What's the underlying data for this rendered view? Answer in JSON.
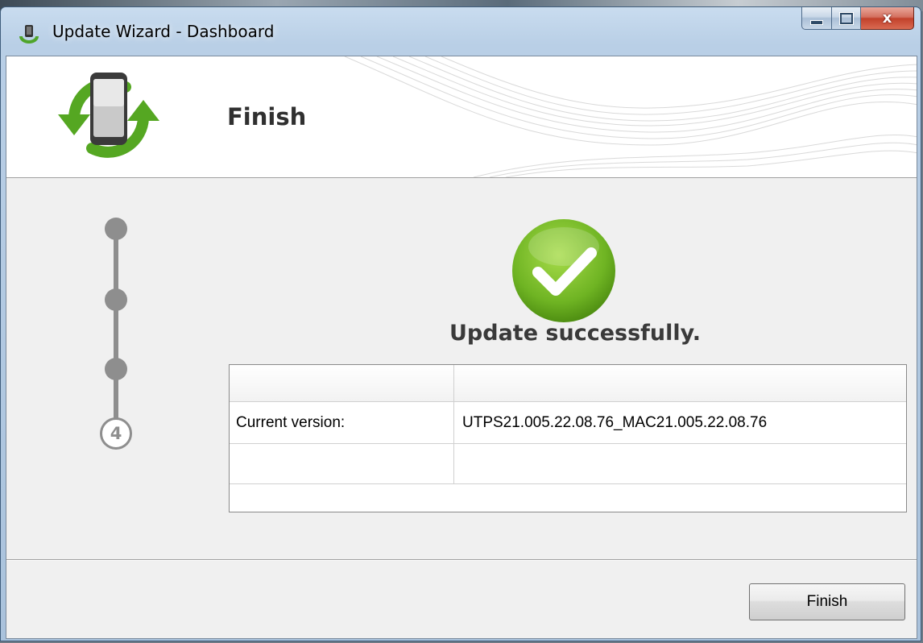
{
  "window": {
    "title": "Update Wizard - Dashboard",
    "close_glyph": "x"
  },
  "icons": {
    "app": "phone-update-icon",
    "logo": "phone-sync-icon",
    "success": "checkmark-icon"
  },
  "header": {
    "title": "Finish"
  },
  "steps": {
    "total": 4,
    "current_label": "4"
  },
  "main": {
    "status": "Update successfully.",
    "table": {
      "header": [
        "",
        ""
      ],
      "rows": [
        {
          "label": "Current version:",
          "value": "UTPS21.005.22.08.76_MAC21.005.22.08.76"
        },
        {
          "label": "",
          "value": ""
        }
      ]
    }
  },
  "footer": {
    "finish_label": "Finish"
  },
  "colors": {
    "success_green": "#7cbf2a",
    "arrow_green": "#55a722",
    "step_gray": "#8e8e8e"
  }
}
